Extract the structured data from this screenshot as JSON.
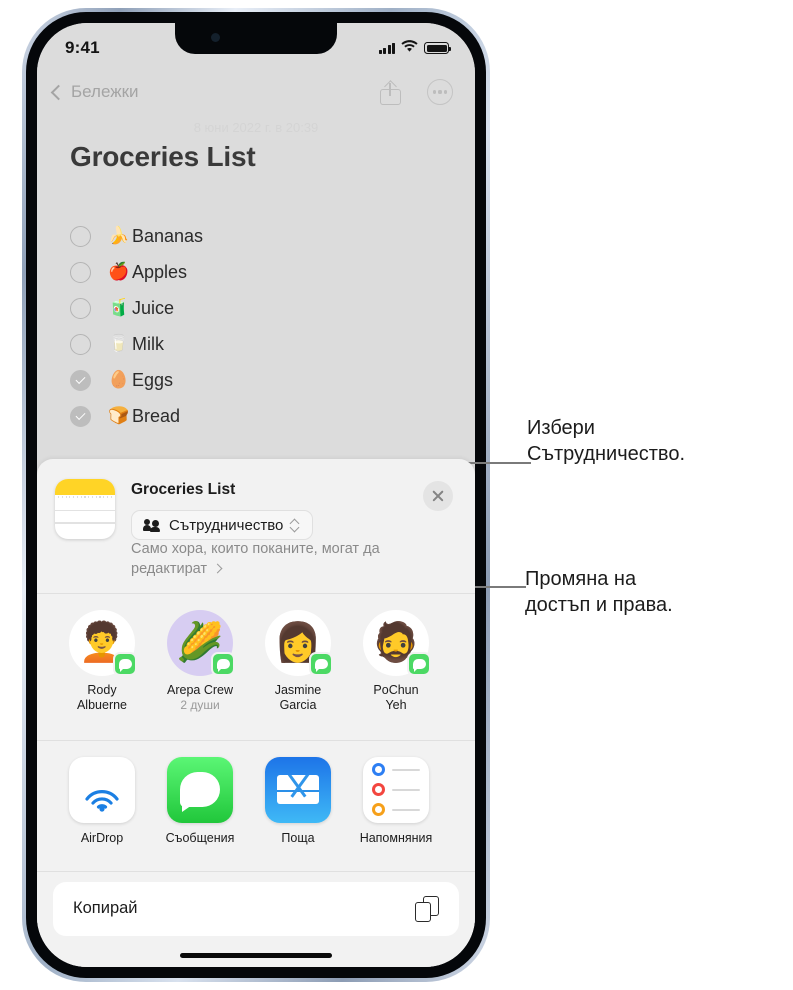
{
  "status_bar": {
    "time": "9:41",
    "signal_icon": "cellular-bars-icon",
    "wifi_icon": "wifi-icon",
    "battery_icon": "battery-full-icon"
  },
  "nav_bar": {
    "back_label": "Бележки",
    "back_icon": "chevron-left-icon",
    "share_icon": "share-icon",
    "more_icon": "more-circle-icon"
  },
  "note": {
    "date": "8 юни 2022 г. в 20:39",
    "title": "Groceries List",
    "items": [
      {
        "label": "Bananas",
        "emoji": "🍌",
        "checked": false
      },
      {
        "label": "Apples",
        "emoji": "🍎",
        "checked": false
      },
      {
        "label": "Juice",
        "emoji": "🧃",
        "checked": false
      },
      {
        "label": "Milk",
        "emoji": "🥛",
        "checked": false
      },
      {
        "label": "Eggs",
        "emoji": "🥚",
        "checked": true
      },
      {
        "label": "Bread",
        "emoji": "🍞",
        "checked": true
      }
    ]
  },
  "share_sheet": {
    "doc_icon": "notes-document-icon",
    "title": "Groceries List",
    "collab_label": "Сътрудничество",
    "collab_people_icon": "people-icon",
    "collab_chevron_icon": "chevron-up-down-icon",
    "permission_text": "Само хора, които поканите, могат да редактират",
    "permission_chevron_icon": "chevron-right-icon",
    "close_icon": "close-icon",
    "contacts": [
      {
        "name": "Rody\nAlbuerne",
        "name_line1": "Rody",
        "name_line2": "Albuerne",
        "sub": "",
        "emoji": "🧑‍🦱",
        "bg": "#ffffff",
        "badge": "messages-badge-icon"
      },
      {
        "name": "Arepa Crew",
        "name_line1": "Arepa Crew",
        "name_line2": "",
        "sub": "2 души",
        "emoji": "🌽",
        "bg": "#d7cdf2",
        "badge": "messages-badge-icon"
      },
      {
        "name": "Jasmine Garcia",
        "name_line1": "Jasmine",
        "name_line2": "Garcia",
        "sub": "",
        "emoji": "👩",
        "bg": "#ffffff",
        "badge": "messages-badge-icon"
      },
      {
        "name": "PoChun Yeh",
        "name_line1": "PoChun",
        "name_line2": "Yeh",
        "sub": "",
        "emoji": "🧔",
        "bg": "#ffffff",
        "badge": "messages-badge-icon"
      }
    ],
    "apps": [
      {
        "label": "AirDrop",
        "icon": "airdrop-icon"
      },
      {
        "label": "Съобщения",
        "icon": "messages-icon"
      },
      {
        "label": "Поща",
        "icon": "mail-icon"
      },
      {
        "label": "Напомняния",
        "icon": "reminders-icon"
      }
    ],
    "copy_label": "Копирай",
    "copy_icon": "copy-icon"
  },
  "callouts": [
    {
      "line1": "Избери",
      "line2": "Сътрудничество."
    },
    {
      "line1": "Промяна на",
      "line2": "достъп и права."
    }
  ],
  "colors": {
    "accent_green": "#4cd964",
    "notes_yellow": "#ffd426",
    "sheet_bg": "#f2f2f2",
    "note_bg": "#dcdcdc"
  }
}
